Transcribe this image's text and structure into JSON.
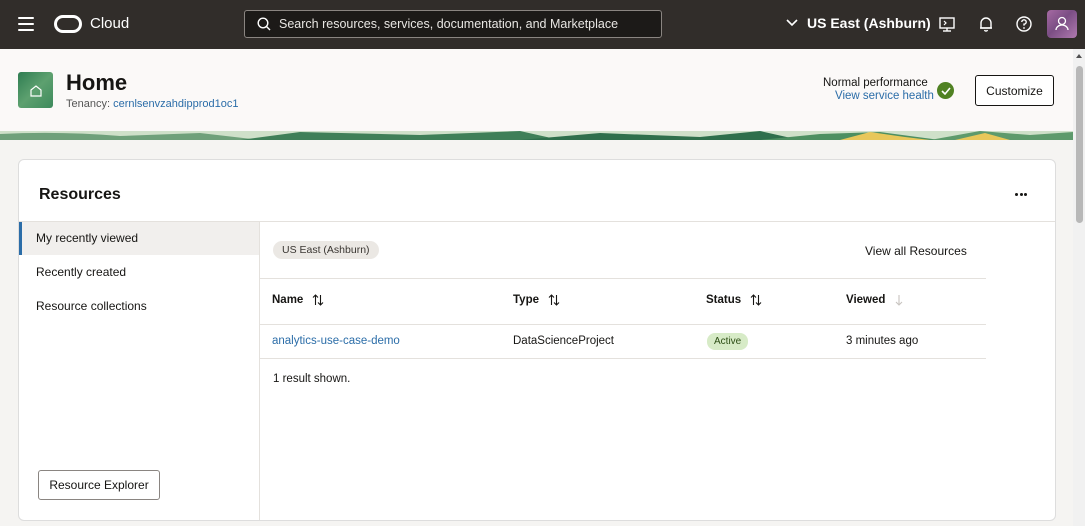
{
  "topbar": {
    "brand": "Cloud",
    "search_placeholder": "Search resources, services, documentation, and Marketplace",
    "region": "US East (Ashburn)",
    "icons": [
      "menu-icon",
      "oracle-logo-icon",
      "search-icon",
      "chevron-down-icon",
      "cloud-shell-icon",
      "bell-icon",
      "help-icon",
      "user-avatar"
    ]
  },
  "header": {
    "title": "Home",
    "tenancy_label": "Tenancy:",
    "tenancy_value": "cernlsenvzahdipprod1oc1",
    "performance_label": "Normal performance",
    "service_health_link": "View service health",
    "customize_label": "Customize"
  },
  "resources": {
    "title": "Resources",
    "nav": [
      {
        "label": "My recently viewed",
        "active": true
      },
      {
        "label": "Recently created",
        "active": false
      },
      {
        "label": "Resource collections",
        "active": false
      }
    ],
    "explorer_button": "Resource Explorer",
    "region_chip": "US East (Ashburn)",
    "view_all": "View all Resources",
    "columns": [
      "Name",
      "Type",
      "Status",
      "Viewed"
    ],
    "rows": [
      {
        "name": "analytics-use-case-demo",
        "type": "DataScienceProject",
        "status": "Active",
        "viewed": "3 minutes ago"
      }
    ],
    "result_text": "1 result shown."
  },
  "colors": {
    "topbar_bg": "#312d2a",
    "link": "#2b6da8",
    "success": "#508223",
    "active_badge_bg": "#d7ebc7"
  }
}
